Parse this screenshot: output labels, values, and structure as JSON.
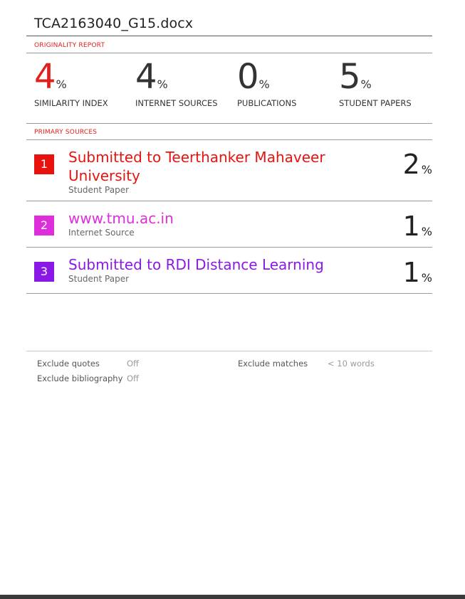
{
  "document": {
    "title": "TCA2163040_G15.docx"
  },
  "report": {
    "originality_label": "ORIGINALITY REPORT",
    "primary_sources_label": "PRIMARY SOURCES"
  },
  "stats": [
    {
      "value": "4",
      "sign": "%",
      "label": "SIMILARITY INDEX",
      "color": "#e0201c"
    },
    {
      "value": "4",
      "sign": "%",
      "label": "INTERNET SOURCES",
      "color": "#333333"
    },
    {
      "value": "0",
      "sign": "%",
      "label": "PUBLICATIONS",
      "color": "#333333"
    },
    {
      "value": "5",
      "sign": "%",
      "label": "STUDENT PAPERS",
      "color": "#333333"
    }
  ],
  "sources": [
    {
      "rank": "1",
      "title": "Submitted to Teerthanker Mahaveer University",
      "type": "Student Paper",
      "percent": "2",
      "sign": "%",
      "color": "#e8130f"
    },
    {
      "rank": "2",
      "title": "www.tmu.ac.in",
      "type": "Internet Source",
      "percent": "1",
      "sign": "%",
      "color": "#de2ddb"
    },
    {
      "rank": "3",
      "title": "Submitted to RDI Distance Learning",
      "type": "Student Paper",
      "percent": "1",
      "sign": "%",
      "color": "#8b19e6"
    }
  ],
  "options": {
    "exclude_quotes_label": "Exclude quotes",
    "exclude_quotes_value": "Off",
    "exclude_bibliography_label": "Exclude bibliography",
    "exclude_bibliography_value": "Off",
    "exclude_matches_label": "Exclude matches",
    "exclude_matches_value": "< 10 words"
  }
}
